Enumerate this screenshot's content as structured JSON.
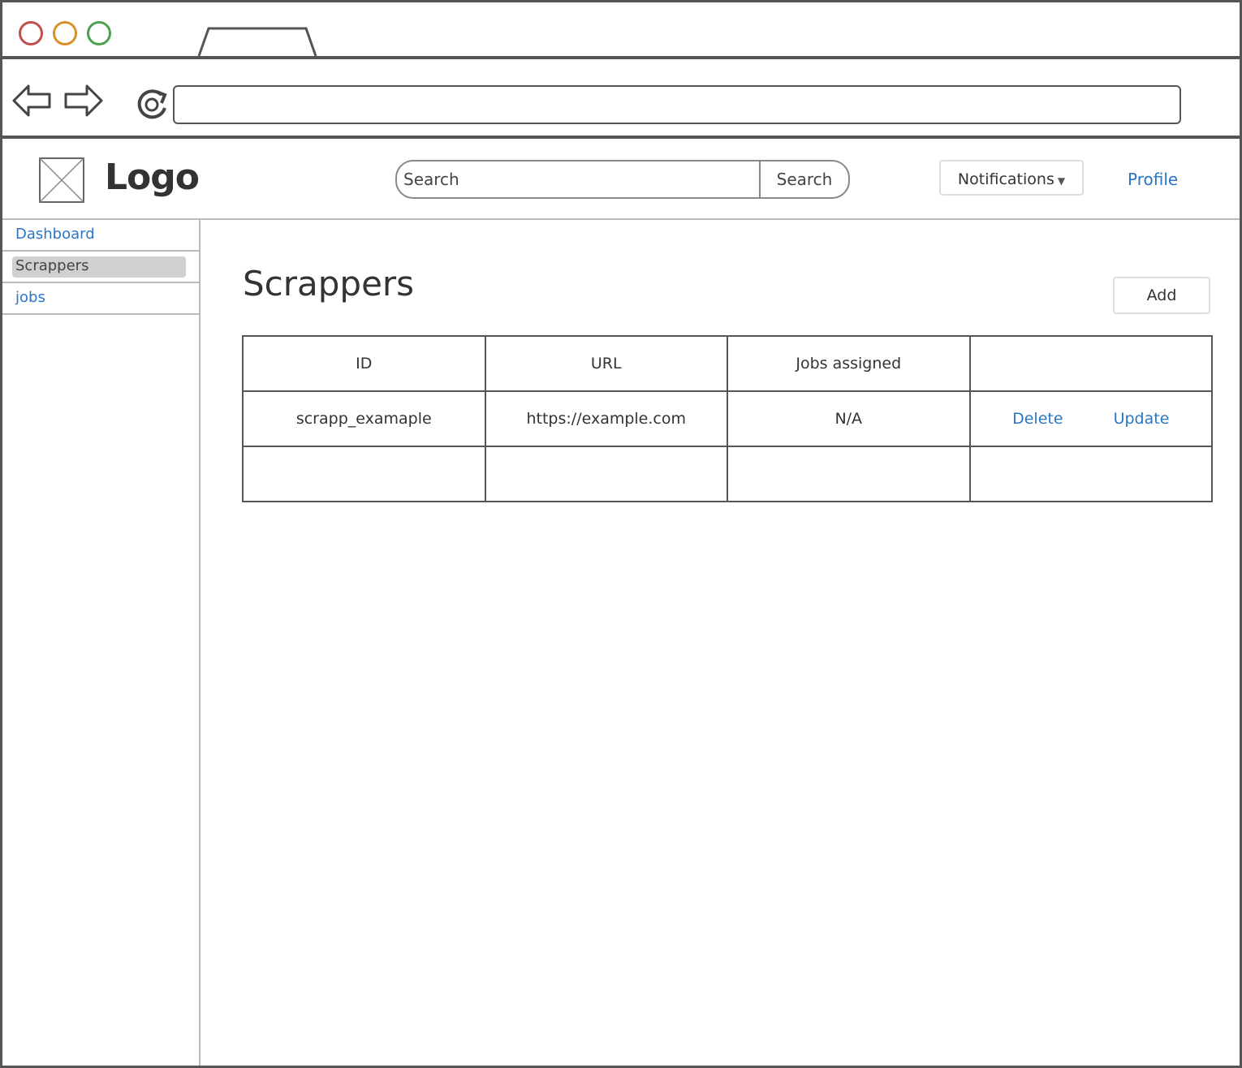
{
  "app": {
    "logo_text": "Logo",
    "search_placeholder": "Search",
    "search_button": "Search",
    "notifications_label": "Notifications",
    "profile_label": "Profile"
  },
  "sidebar": {
    "items": [
      {
        "label": "Dashboard",
        "active": false
      },
      {
        "label": "Scrappers",
        "active": true
      },
      {
        "label": "jobs",
        "active": false
      }
    ]
  },
  "main": {
    "title": "Scrappers",
    "add_label": "Add",
    "table": {
      "headers": [
        "ID",
        "URL",
        "Jobs assigned",
        ""
      ],
      "rows": [
        {
          "id": "scrapp_examaple",
          "url": "https://example.com",
          "jobs": "N/A",
          "actions": [
            "Delete",
            "Update"
          ]
        },
        {
          "id": "",
          "url": "",
          "jobs": "",
          "actions": []
        }
      ]
    }
  },
  "colors": {
    "link": "#2a76c6",
    "window_red": "#c0504d",
    "window_orange": "#d9912b",
    "window_green": "#4ea24c"
  }
}
